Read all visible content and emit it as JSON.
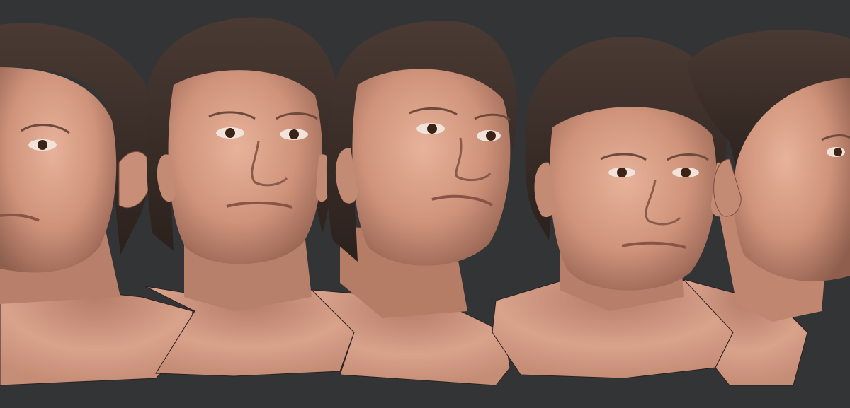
{
  "scene": {
    "background_color": "#333436",
    "skin_color": "#d49a83",
    "skin_shadow_color": "#8a5a4a",
    "hair_color": "#3a2d28",
    "busts": [
      {
        "view": "left-three-quarter-cropped"
      },
      {
        "view": "front"
      },
      {
        "view": "three-quarter-right"
      },
      {
        "view": "front-lower-angle"
      },
      {
        "view": "right-profile-cropped"
      }
    ]
  }
}
